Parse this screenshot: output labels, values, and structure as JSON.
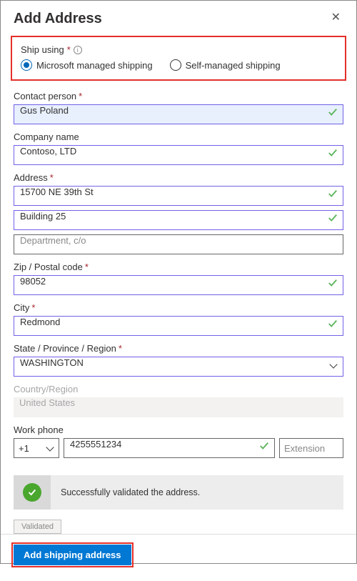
{
  "header": {
    "title": "Add Address"
  },
  "shipUsing": {
    "label": "Ship using",
    "options": {
      "managed": "Microsoft managed shipping",
      "self": "Self-managed shipping"
    },
    "selected": "managed"
  },
  "fields": {
    "contact": {
      "label": "Contact person",
      "value": "Gus Poland",
      "required": true,
      "validated": true
    },
    "company": {
      "label": "Company name",
      "value": "Contoso, LTD",
      "required": false,
      "validated": true
    },
    "address": {
      "label": "Address",
      "required": true,
      "line1": "15700 NE 39th St",
      "line2": "Building 25",
      "line3_placeholder": "Department, c/o"
    },
    "zip": {
      "label": "Zip / Postal code",
      "value": "98052",
      "required": true,
      "validated": true
    },
    "city": {
      "label": "City",
      "value": "Redmond",
      "required": true,
      "validated": true
    },
    "state": {
      "label": "State / Province / Region",
      "value": "WASHINGTON",
      "required": true
    },
    "country": {
      "label": "Country/Region",
      "value": "United States"
    },
    "phone": {
      "label": "Work phone",
      "countryCode": "+1",
      "number": "4255551234",
      "ext_placeholder": "Extension"
    }
  },
  "validation": {
    "banner": "Successfully validated the address.",
    "chip": "Validated"
  },
  "footer": {
    "submit": "Add shipping address"
  }
}
